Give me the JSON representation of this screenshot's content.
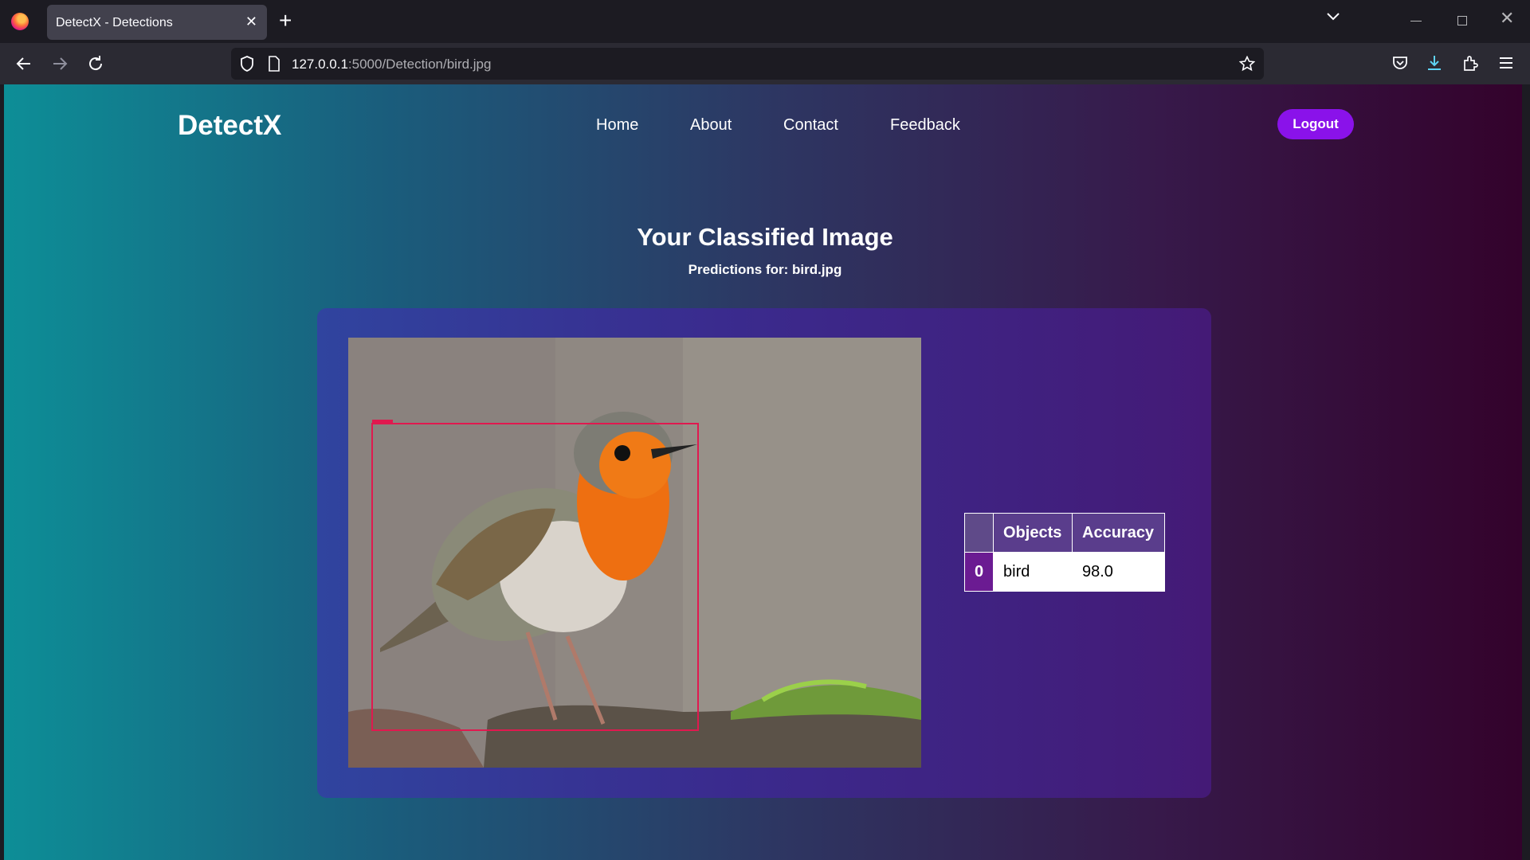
{
  "browser": {
    "tab_title": "DetectX - Detections",
    "url_host": "127.0.0.1",
    "url_path": ":5000/Detection/bird.jpg"
  },
  "site": {
    "brand": "DetectX",
    "nav": [
      "Home",
      "About",
      "Contact",
      "Feedback"
    ],
    "logout_label": "Logout"
  },
  "main": {
    "title": "Your Classified Image",
    "subtitle": "Predictions for: bird.jpg"
  },
  "results": {
    "headers": [
      "",
      "Objects",
      "Accuracy"
    ],
    "rows": [
      {
        "index": "0",
        "object": "bird",
        "accuracy": "98.0"
      }
    ]
  },
  "colors": {
    "logout_button": "#8a12ea",
    "bounding_box": "#e0194f"
  }
}
